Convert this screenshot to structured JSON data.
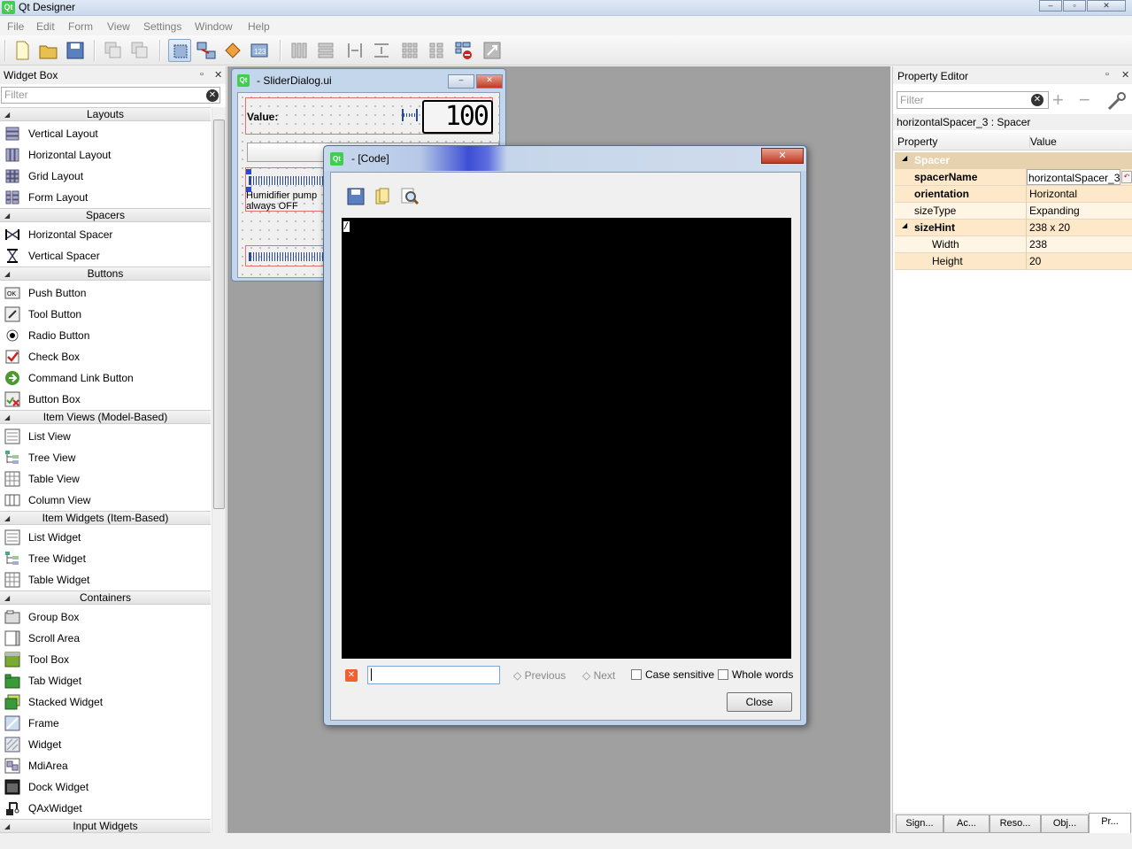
{
  "app": {
    "title": "Qt Designer",
    "window_controls": [
      "–",
      "▫",
      "✕"
    ],
    "app_icon_text": "Qt"
  },
  "menu": [
    "File",
    "Edit",
    "Form",
    "View",
    "Settings",
    "Window",
    "Help"
  ],
  "widget_box": {
    "title": "Widget Box",
    "filter_placeholder": "Filter",
    "categories": [
      {
        "name": "Layouts",
        "items": [
          "Vertical Layout",
          "Horizontal Layout",
          "Grid Layout",
          "Form Layout"
        ]
      },
      {
        "name": "Spacers",
        "items": [
          "Horizontal Spacer",
          "Vertical Spacer"
        ]
      },
      {
        "name": "Buttons",
        "items": [
          "Push Button",
          "Tool Button",
          "Radio Button",
          "Check Box",
          "Command Link Button",
          "Button Box"
        ]
      },
      {
        "name": "Item Views (Model-Based)",
        "items": [
          "List View",
          "Tree View",
          "Table View",
          "Column View"
        ]
      },
      {
        "name": "Item Widgets (Item-Based)",
        "items": [
          "List Widget",
          "Tree Widget",
          "Table Widget"
        ]
      },
      {
        "name": "Containers",
        "items": [
          "Group Box",
          "Scroll Area",
          "Tool Box",
          "Tab Widget",
          "Stacked Widget",
          "Frame",
          "Widget",
          "MdiArea",
          "Dock Widget",
          "QAxWidget"
        ]
      },
      {
        "name": "Input Widgets",
        "items": []
      }
    ]
  },
  "slider_dialog": {
    "title": "- SliderDialog.ui",
    "value_label": "Value:",
    "lcd_value": "100",
    "pump_label_line1": "Humidifier pump",
    "pump_label_line2": "always OFF"
  },
  "code_dialog": {
    "title": "- [Code]",
    "code_text": "/",
    "previous_label": "Previous",
    "next_label": "Next",
    "case_sensitive_label": "Case sensitive",
    "whole_words_label": "Whole words",
    "close_label": "Close",
    "search_value": ""
  },
  "property_editor": {
    "title": "Property Editor",
    "filter_placeholder": "Filter",
    "object_label": "horizontalSpacer_3 : Spacer",
    "col_property": "Property",
    "col_value": "Value",
    "group": "Spacer",
    "rows": [
      {
        "name": "spacerName",
        "value": "horizontalSpacer_3"
      },
      {
        "name": "orientation",
        "value": "Horizontal"
      },
      {
        "name": "sizeType",
        "value": "Expanding"
      },
      {
        "name": "sizeHint",
        "value": "238 x 20"
      },
      {
        "name": "Width",
        "value": "238"
      },
      {
        "name": "Height",
        "value": "20"
      }
    ],
    "tabs": [
      "Sign...",
      "Ac...",
      "Reso...",
      "Obj...",
      "Pr..."
    ]
  },
  "colors": {
    "accent": "#3c4ed4",
    "property_highlight": "#fde9c9",
    "property_group": "#e6d2ae",
    "mdi_background": "#a0a0a0",
    "qt_green": "#41cd52"
  }
}
